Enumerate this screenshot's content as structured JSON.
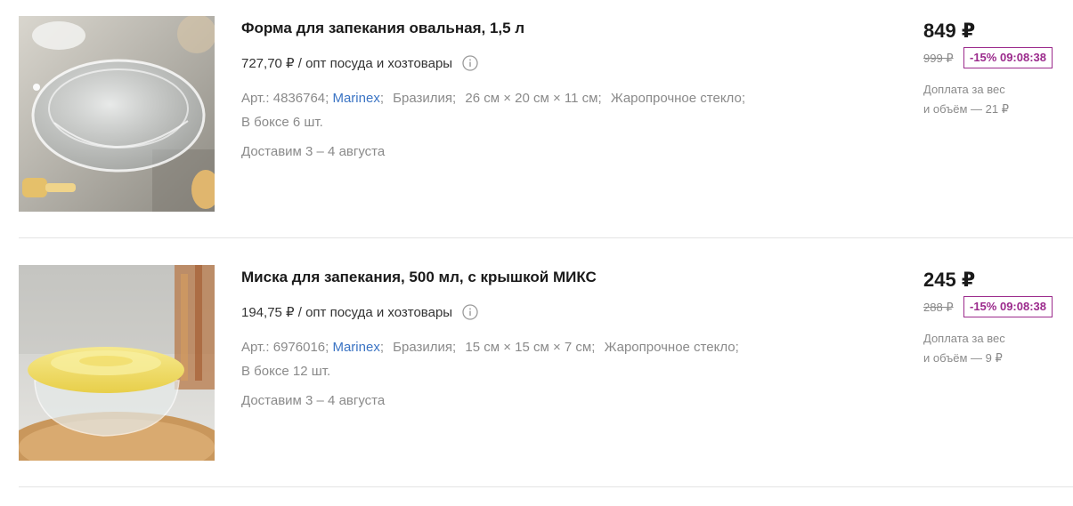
{
  "products": [
    {
      "title": "Форма для запекания овальная, 1,5 л",
      "opt_price": "727,70 ₽ / опт посуда и хозтовары",
      "article": "Арт.: 4836764;",
      "brand": "Marinex",
      "brand_sep": ";",
      "country": "Бразилия;",
      "size": "26 см × 20 см × 11 см;",
      "material": "Жаропрочное стекло;",
      "box": "В боксе 6 шт.",
      "delivery": "Доставим 3 – 4 августа",
      "price": "849 ₽",
      "old_price": "999 ₽",
      "discount": "-15% 09:08:38",
      "extra_line1": "Доплата за вес",
      "extra_line2": "и объём — 21 ₽",
      "image": "glass-oval-baking-dish"
    },
    {
      "title": "Миска для запекания, 500 мл, с крышкой МИКС",
      "opt_price": "194,75 ₽ / опт посуда и хозтовары",
      "article": "Арт.: 6976016;",
      "brand": "Marinex",
      "brand_sep": ";",
      "country": "Бразилия;",
      "size": "15 см × 15 см × 7 см;",
      "material": "Жаропрочное стекло;",
      "box": "В боксе 12 шт.",
      "delivery": "Доставим 3 – 4 августа",
      "price": "245 ₽",
      "old_price": "288 ₽",
      "discount": "-15% 09:08:38",
      "extra_line1": "Доплата за вес",
      "extra_line2": "и объём — 9 ₽",
      "image": "glass-bowl-with-yellow-lid"
    }
  ],
  "colors": {
    "accent_discount": "#9b2a8c",
    "brand_link": "#3b74c4",
    "muted_text": "#8a8a8a",
    "divider": "#e3e3e3"
  },
  "icons": [
    "info-icon"
  ]
}
